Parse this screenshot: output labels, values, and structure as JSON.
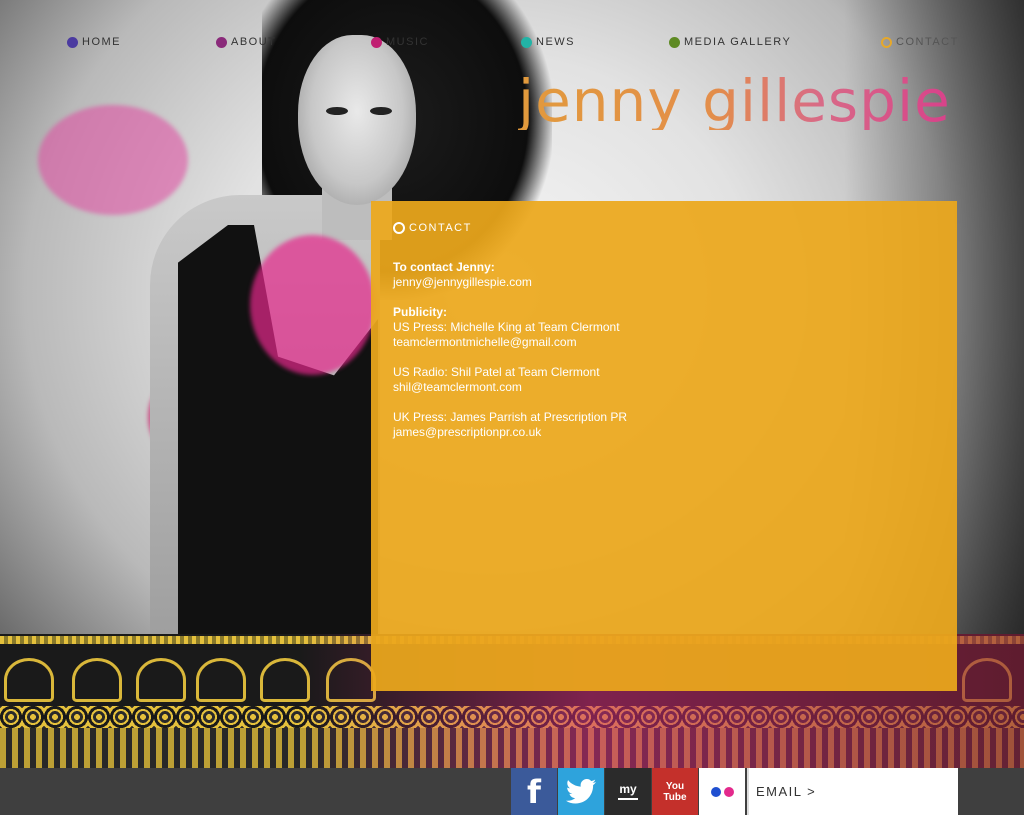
{
  "nav": {
    "items": [
      {
        "label": "HOME",
        "color": "#4b3aa0"
      },
      {
        "label": "ABOUT",
        "color": "#8a2a7a"
      },
      {
        "label": "MUSIC",
        "color": "#c01f72"
      },
      {
        "label": "NEWS",
        "color": "#22b3a6"
      },
      {
        "label": "MEDIA GALLERY",
        "color": "#5e8a23"
      },
      {
        "label": "CONTACT",
        "color": "#e6a82b"
      }
    ]
  },
  "brand": {
    "name": "jenny gillespie"
  },
  "panel": {
    "heading": "CONTACT",
    "blocks": [
      {
        "title": "To contact Jenny:",
        "lines": [
          "jenny@jennygillespie.com"
        ]
      },
      {
        "title": "Publicity:",
        "lines": [
          "US Press: Michelle King at Team Clermont",
          "teamclermontmichelle@gmail.com"
        ]
      },
      {
        "title": "",
        "lines": [
          "US Radio: Shil Patel at Team Clermont",
          "shil@teamclermont.com"
        ]
      },
      {
        "title": "",
        "lines": [
          "UK Press: James Parrish at Prescription PR",
          "james@prescriptionpr.co.uk"
        ]
      }
    ],
    "background": "#eca81c"
  },
  "footer": {
    "social": [
      {
        "icon": "facebook-icon",
        "text": "f",
        "color": "#3b5a9a"
      },
      {
        "icon": "twitter-icon",
        "text": "🐦",
        "color": "#2ea3dc"
      },
      {
        "icon": "myspace-icon",
        "text": "my",
        "color": "#2b2b2b"
      },
      {
        "icon": "youtube-icon",
        "text": "You Tube",
        "color": "#c4302b"
      },
      {
        "icon": "flickr-icon",
        "text": "",
        "color": "#ffffff"
      }
    ],
    "email_label": "EMAIL >"
  }
}
